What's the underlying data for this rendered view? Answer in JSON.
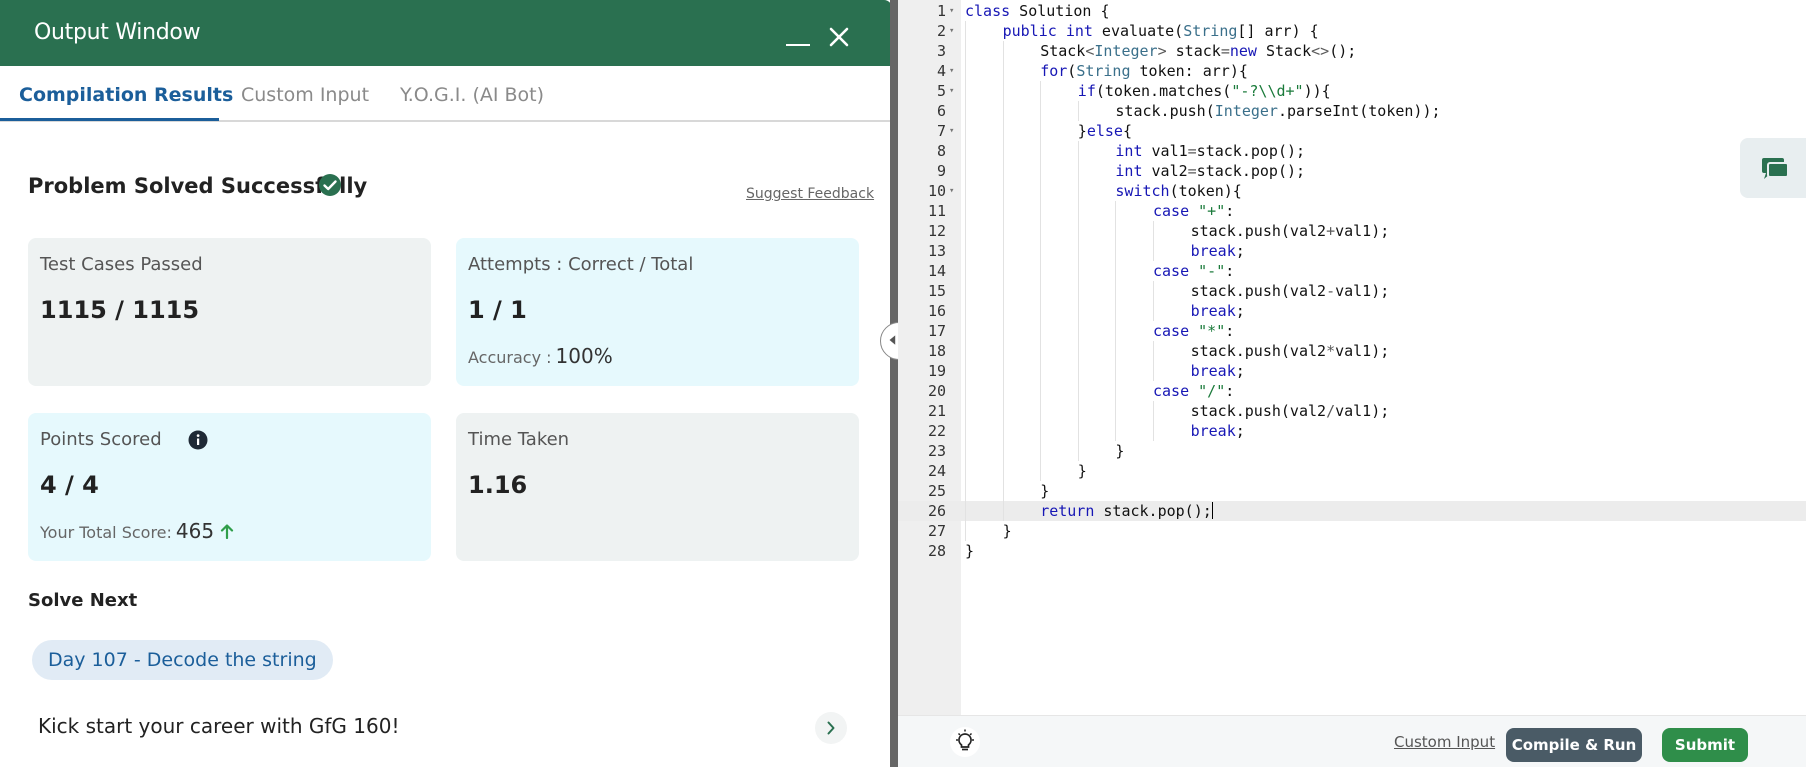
{
  "output_window": {
    "title": "Output Window",
    "tabs": [
      {
        "label": "Compilation Results",
        "active": true
      },
      {
        "label": "Custom Input",
        "active": false
      },
      {
        "label": "Y.O.G.I. (AI Bot)",
        "active": false
      }
    ],
    "status": "Problem Solved Successfully",
    "status_icon": "check-circle-icon",
    "suggest_feedback": "Suggest Feedback",
    "cards": {
      "test_cases": {
        "label": "Test Cases Passed",
        "value": "1115 / 1115"
      },
      "attempts": {
        "label": "Attempts : Correct / Total",
        "value": "1 / 1",
        "sub_label": "Accuracy :",
        "sub_value": "100%"
      },
      "points": {
        "label": "Points Scored",
        "value": "4 / 4",
        "sub_label": "Your Total Score:",
        "sub_value": "465"
      },
      "time": {
        "label": "Time Taken",
        "value": "1.16"
      }
    },
    "solve_next": {
      "heading": "Solve Next",
      "problem": "Day 107 - Decode the string",
      "promo": "Kick start your career with GfG 160!"
    }
  },
  "editor": {
    "active_line": 26,
    "lines": [
      {
        "n": 1,
        "fold": true,
        "indent": 0,
        "html": "<span class='kw'>class</span> Solution {"
      },
      {
        "n": 2,
        "fold": true,
        "indent": 1,
        "html": "<span class='kw'>public</span> <span class='kw'>int</span> evaluate(<span class='ty'>String</span>[] arr) {"
      },
      {
        "n": 3,
        "fold": false,
        "indent": 2,
        "html": "Stack<span class='op'>&lt;</span><span class='ty'>Integer</span><span class='op'>&gt;</span> stack<span class='op'>=</span><span class='kw'>new</span> Stack<span class='op'>&lt;&gt;</span>();"
      },
      {
        "n": 4,
        "fold": true,
        "indent": 2,
        "html": "<span class='kw'>for</span>(<span class='ty'>String</span> token: arr){"
      },
      {
        "n": 5,
        "fold": true,
        "indent": 3,
        "html": "<span class='kw'>if</span>(token.matches(<span class='st'>\"-?\\\\d+\"</span>)){"
      },
      {
        "n": 6,
        "fold": false,
        "indent": 4,
        "html": "stack.push(<span class='ty'>Integer</span>.parseInt(token));"
      },
      {
        "n": 7,
        "fold": true,
        "indent": 3,
        "html": "}<span class='kw'>else</span>{"
      },
      {
        "n": 8,
        "fold": false,
        "indent": 4,
        "html": "<span class='kw'>int</span> val1<span class='op'>=</span>stack.pop();"
      },
      {
        "n": 9,
        "fold": false,
        "indent": 4,
        "html": "<span class='kw'>int</span> val2<span class='op'>=</span>stack.pop();"
      },
      {
        "n": 10,
        "fold": true,
        "indent": 4,
        "html": "<span class='kw'>switch</span>(token){"
      },
      {
        "n": 11,
        "fold": false,
        "indent": 5,
        "html": "<span class='kw'>case</span> <span class='st'>\"+\"</span>:"
      },
      {
        "n": 12,
        "fold": false,
        "indent": 6,
        "html": "stack.push(val2<span class='op'>+</span>val1);"
      },
      {
        "n": 13,
        "fold": false,
        "indent": 6,
        "html": "<span class='kw'>break</span>;"
      },
      {
        "n": 14,
        "fold": false,
        "indent": 5,
        "html": "<span class='kw'>case</span> <span class='st'>\"-\"</span>:"
      },
      {
        "n": 15,
        "fold": false,
        "indent": 6,
        "html": "stack.push(val2<span class='op'>-</span>val1);"
      },
      {
        "n": 16,
        "fold": false,
        "indent": 6,
        "html": "<span class='kw'>break</span>;"
      },
      {
        "n": 17,
        "fold": false,
        "indent": 5,
        "html": "<span class='kw'>case</span> <span class='st'>\"*\"</span>:"
      },
      {
        "n": 18,
        "fold": false,
        "indent": 6,
        "html": "stack.push(val2<span class='op'>*</span>val1);"
      },
      {
        "n": 19,
        "fold": false,
        "indent": 6,
        "html": "<span class='kw'>break</span>;"
      },
      {
        "n": 20,
        "fold": false,
        "indent": 5,
        "html": "<span class='kw'>case</span> <span class='st'>\"/\"</span>:"
      },
      {
        "n": 21,
        "fold": false,
        "indent": 6,
        "html": "stack.push(val2<span class='op'>/</span>val1);"
      },
      {
        "n": 22,
        "fold": false,
        "indent": 6,
        "html": "<span class='kw'>break</span>;"
      },
      {
        "n": 23,
        "fold": false,
        "indent": 4,
        "html": "}"
      },
      {
        "n": 24,
        "fold": false,
        "indent": 3,
        "html": "}"
      },
      {
        "n": 25,
        "fold": false,
        "indent": 2,
        "html": "}"
      },
      {
        "n": 26,
        "fold": false,
        "indent": 2,
        "html": "<span class='kw'>return</span> stack.pop();"
      },
      {
        "n": 27,
        "fold": false,
        "indent": 1,
        "html": "}"
      },
      {
        "n": 28,
        "fold": false,
        "indent": 0,
        "html": "}"
      }
    ]
  },
  "bottom_bar": {
    "custom_input": "Custom Input",
    "compile_run": "Compile & Run",
    "submit": "Submit"
  },
  "colors": {
    "header_green": "#2a7050",
    "tab_active_blue": "#1b5e9a",
    "submit_green": "#2f8e4a",
    "compile_grey": "#4a5b66"
  }
}
